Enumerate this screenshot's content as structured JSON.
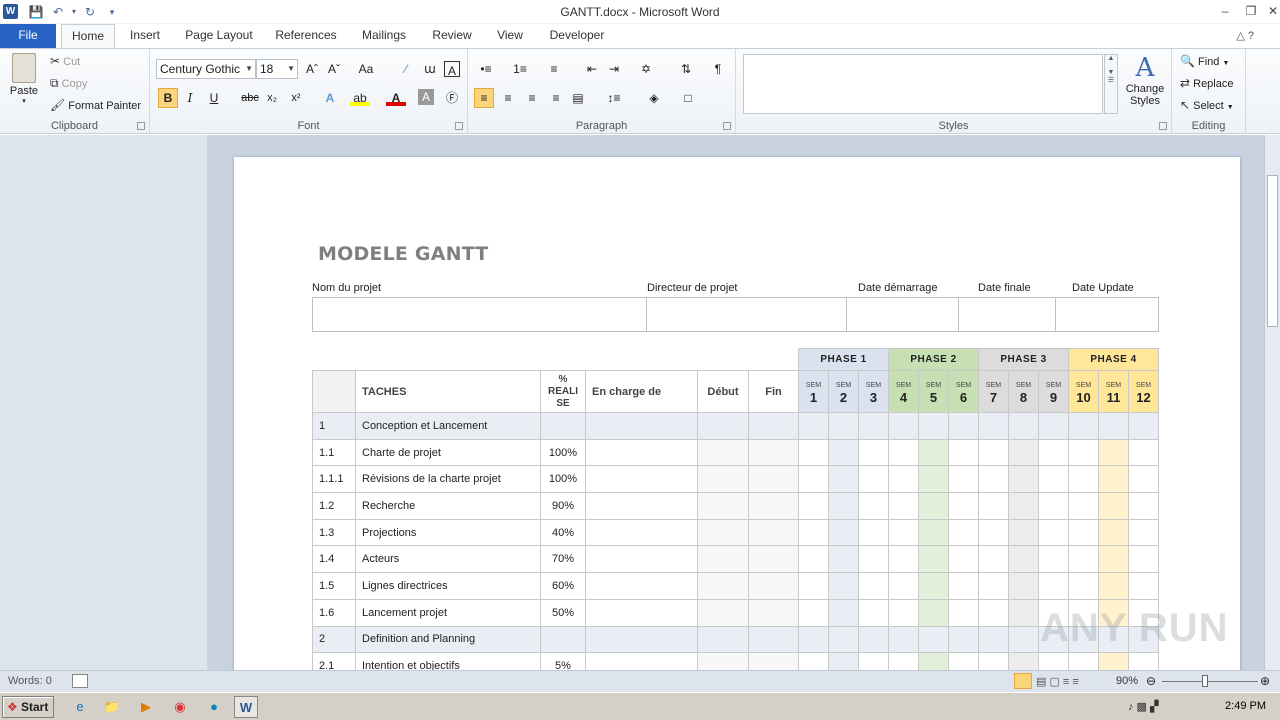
{
  "window": {
    "title": "GANTT.docx - Microsoft Word"
  },
  "tabs": [
    "File",
    "Home",
    "Insert",
    "Page Layout",
    "References",
    "Mailings",
    "Review",
    "View",
    "Developer"
  ],
  "clipboard": {
    "paste": "Paste",
    "cut": "Cut",
    "copy": "Copy",
    "format_painter": "Format Painter",
    "label": "Clipboard"
  },
  "font": {
    "name": "Century Gothic",
    "size": "18",
    "label": "Font"
  },
  "paragraph": {
    "label": "Paragraph"
  },
  "styles": {
    "label": "Styles",
    "change": "Change",
    "styles_word": "Styles"
  },
  "editing": {
    "find": "Find",
    "replace": "Replace",
    "select": "Select",
    "label": "Editing"
  },
  "doc": {
    "title": "MODELE GANTT",
    "project_labels": [
      "Nom du projet",
      "Directeur de projet",
      "Date démarrage",
      "Date finale",
      "Date Update"
    ],
    "phases": [
      "PHASE 1",
      "PHASE 2",
      "PHASE 3",
      "PHASE 4"
    ],
    "phase_colors": [
      "#d9e2ee",
      "#c6e0b4",
      "#dcdcdc",
      "#ffe699"
    ],
    "col_headers": {
      "taches": "TACHES",
      "pct": "% REALI SE",
      "encharge": "En charge de",
      "debut": "Début",
      "fin": "Fin",
      "sem": "SEM"
    },
    "weeks": [
      "1",
      "2",
      "3",
      "4",
      "5",
      "6",
      "7",
      "8",
      "9",
      "10",
      "11",
      "12"
    ],
    "rows": [
      {
        "id": "1",
        "task": "Conception et  Lancement",
        "pct": "",
        "group": true
      },
      {
        "id": "1.1",
        "task": "Charte de projet",
        "pct": "100%"
      },
      {
        "id": "1.1.1",
        "task": "Révisions de la charte projet",
        "pct": "100%"
      },
      {
        "id": "1.2",
        "task": "Recherche",
        "pct": "90%"
      },
      {
        "id": "1.3",
        "task": "Projections",
        "pct": "40%"
      },
      {
        "id": "1.4",
        "task": "Acteurs",
        "pct": "70%"
      },
      {
        "id": "1.5",
        "task": "Lignes directrices",
        "pct": "60%"
      },
      {
        "id": "1.6",
        "task": "Lancement projet",
        "pct": "50%"
      },
      {
        "id": "2",
        "task": "Definition and Planning",
        "pct": "",
        "group": true
      },
      {
        "id": "2.1",
        "task": "Intention et objectifs",
        "pct": "5%"
      }
    ]
  },
  "status": {
    "words": "Words: 0",
    "zoom": "90%"
  },
  "taskbar": {
    "start": "Start",
    "clock": "2:49 PM"
  },
  "watermark": "ANY RUN"
}
